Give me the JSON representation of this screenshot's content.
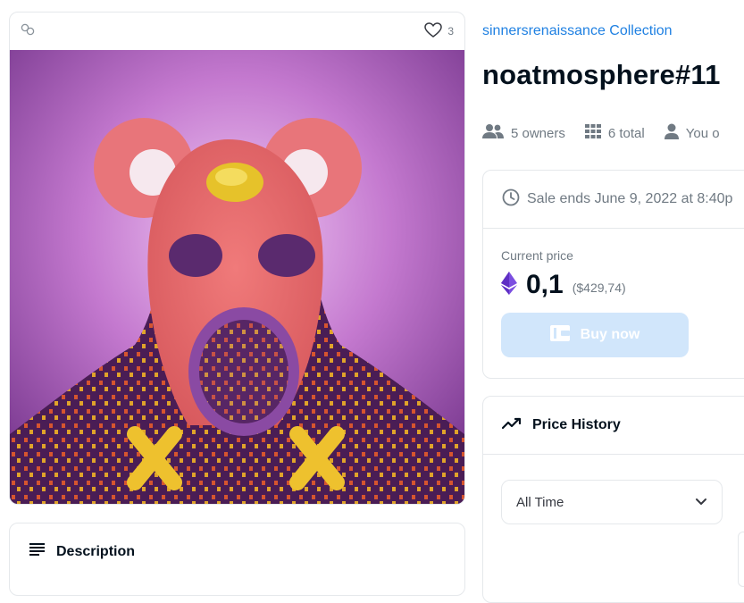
{
  "card": {
    "favorite_count": "3"
  },
  "description": {
    "label": "Description"
  },
  "collection": {
    "name": "sinnersrenaissance Collection"
  },
  "item": {
    "title": "noatmosphere#11"
  },
  "stats": {
    "owners": "5 owners",
    "total": "6 total",
    "you_own": "You o"
  },
  "sale": {
    "ends": "Sale ends June 9, 2022 at 8:40p",
    "current_label": "Current price",
    "price": "0,1",
    "usd": "($429,74)",
    "buy_label": "Buy now"
  },
  "history": {
    "title": "Price History",
    "range_value": "All Time"
  },
  "colors": {
    "link": "#2081e2",
    "buy_disabled": "#d1e6fb",
    "eth": "#6a3bd6",
    "art_bg": "#b96bc5"
  },
  "icons": [
    "link-icon",
    "heart-icon",
    "lines-icon",
    "owners-icon",
    "grid-icon",
    "person-icon",
    "clock-icon",
    "eth-icon",
    "wallet-icon",
    "trend-icon",
    "chevron-down-icon"
  ]
}
